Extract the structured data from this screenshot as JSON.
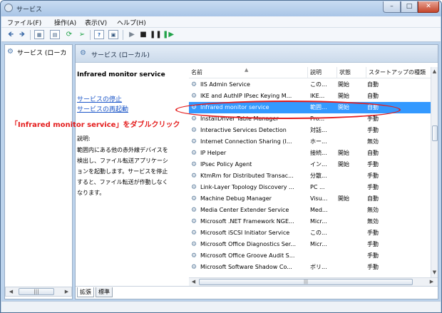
{
  "window": {
    "title": "サービス"
  },
  "menu": [
    "ファイル(F)",
    "操作(A)",
    "表示(V)",
    "ヘルプ(H)"
  ],
  "tree": {
    "item": "サービス (ローカ"
  },
  "pane": {
    "title": "サービス (ローカル)"
  },
  "detail": {
    "title": "Infrared monitor service",
    "links": [
      "サービスの停止",
      "サービスの再起動"
    ],
    "desc_label": "説明:",
    "desc_lines": [
      "範囲内にある他の赤外線デバイスを",
      "検出し、ファイル転送アプリケーシ",
      "ョンを起動します。サービスを停止",
      "すると、ファイル転送が作動しなく",
      "なります。"
    ]
  },
  "columns": [
    "名前",
    "説明",
    "状態",
    "スタートアップの種類"
  ],
  "rows": [
    {
      "name": "IIS Admin Service",
      "desc": "この...",
      "status": "開始",
      "startup": "自動"
    },
    {
      "name": "IKE and AuthIP IPsec Keying M...",
      "desc": "IKE...",
      "status": "開始",
      "startup": "自動"
    },
    {
      "name": "Infrared monitor service",
      "desc": "範囲...",
      "status": "開始",
      "startup": "自動"
    },
    {
      "name": "InstallDriver Table Manager",
      "desc": "Pro...",
      "status": "",
      "startup": "手動"
    },
    {
      "name": "Interactive Services Detection",
      "desc": "対話...",
      "status": "",
      "startup": "手動"
    },
    {
      "name": "Internet Connection Sharing (I...",
      "desc": "ホー...",
      "status": "",
      "startup": "無効"
    },
    {
      "name": "IP Helper",
      "desc": "接続...",
      "status": "開始",
      "startup": "自動"
    },
    {
      "name": "IPsec Policy Agent",
      "desc": "イン...",
      "status": "開始",
      "startup": "手動"
    },
    {
      "name": "KtmRm for Distributed Transac...",
      "desc": "分散...",
      "status": "",
      "startup": "手動"
    },
    {
      "name": "Link-Layer Topology Discovery ...",
      "desc": "PC ...",
      "status": "",
      "startup": "手動"
    },
    {
      "name": "Machine Debug Manager",
      "desc": "Visu...",
      "status": "開始",
      "startup": "自動"
    },
    {
      "name": "Media Center Extender Service",
      "desc": "Med...",
      "status": "",
      "startup": "無効"
    },
    {
      "name": "Microsoft .NET Framework NGE...",
      "desc": "Micr...",
      "status": "",
      "startup": "無効"
    },
    {
      "name": "Microsoft iSCSI Initiator Service",
      "desc": "この...",
      "status": "",
      "startup": "手動"
    },
    {
      "name": "Microsoft Office Diagnostics Ser...",
      "desc": "Micr...",
      "status": "",
      "startup": "手動"
    },
    {
      "name": "Microsoft Office Groove Audit S...",
      "desc": "",
      "status": "",
      "startup": "手動"
    },
    {
      "name": "Microsoft Software Shadow Co...",
      "desc": "ボリ...",
      "status": "",
      "startup": "手動"
    }
  ],
  "tabs": [
    "拡張",
    "標準"
  ],
  "annotation": "「Infrared monitor service」をダブルクリック",
  "colors": {
    "selection": "#3399ff",
    "annotation": "#e41c1c",
    "link": "#1a55c8"
  }
}
